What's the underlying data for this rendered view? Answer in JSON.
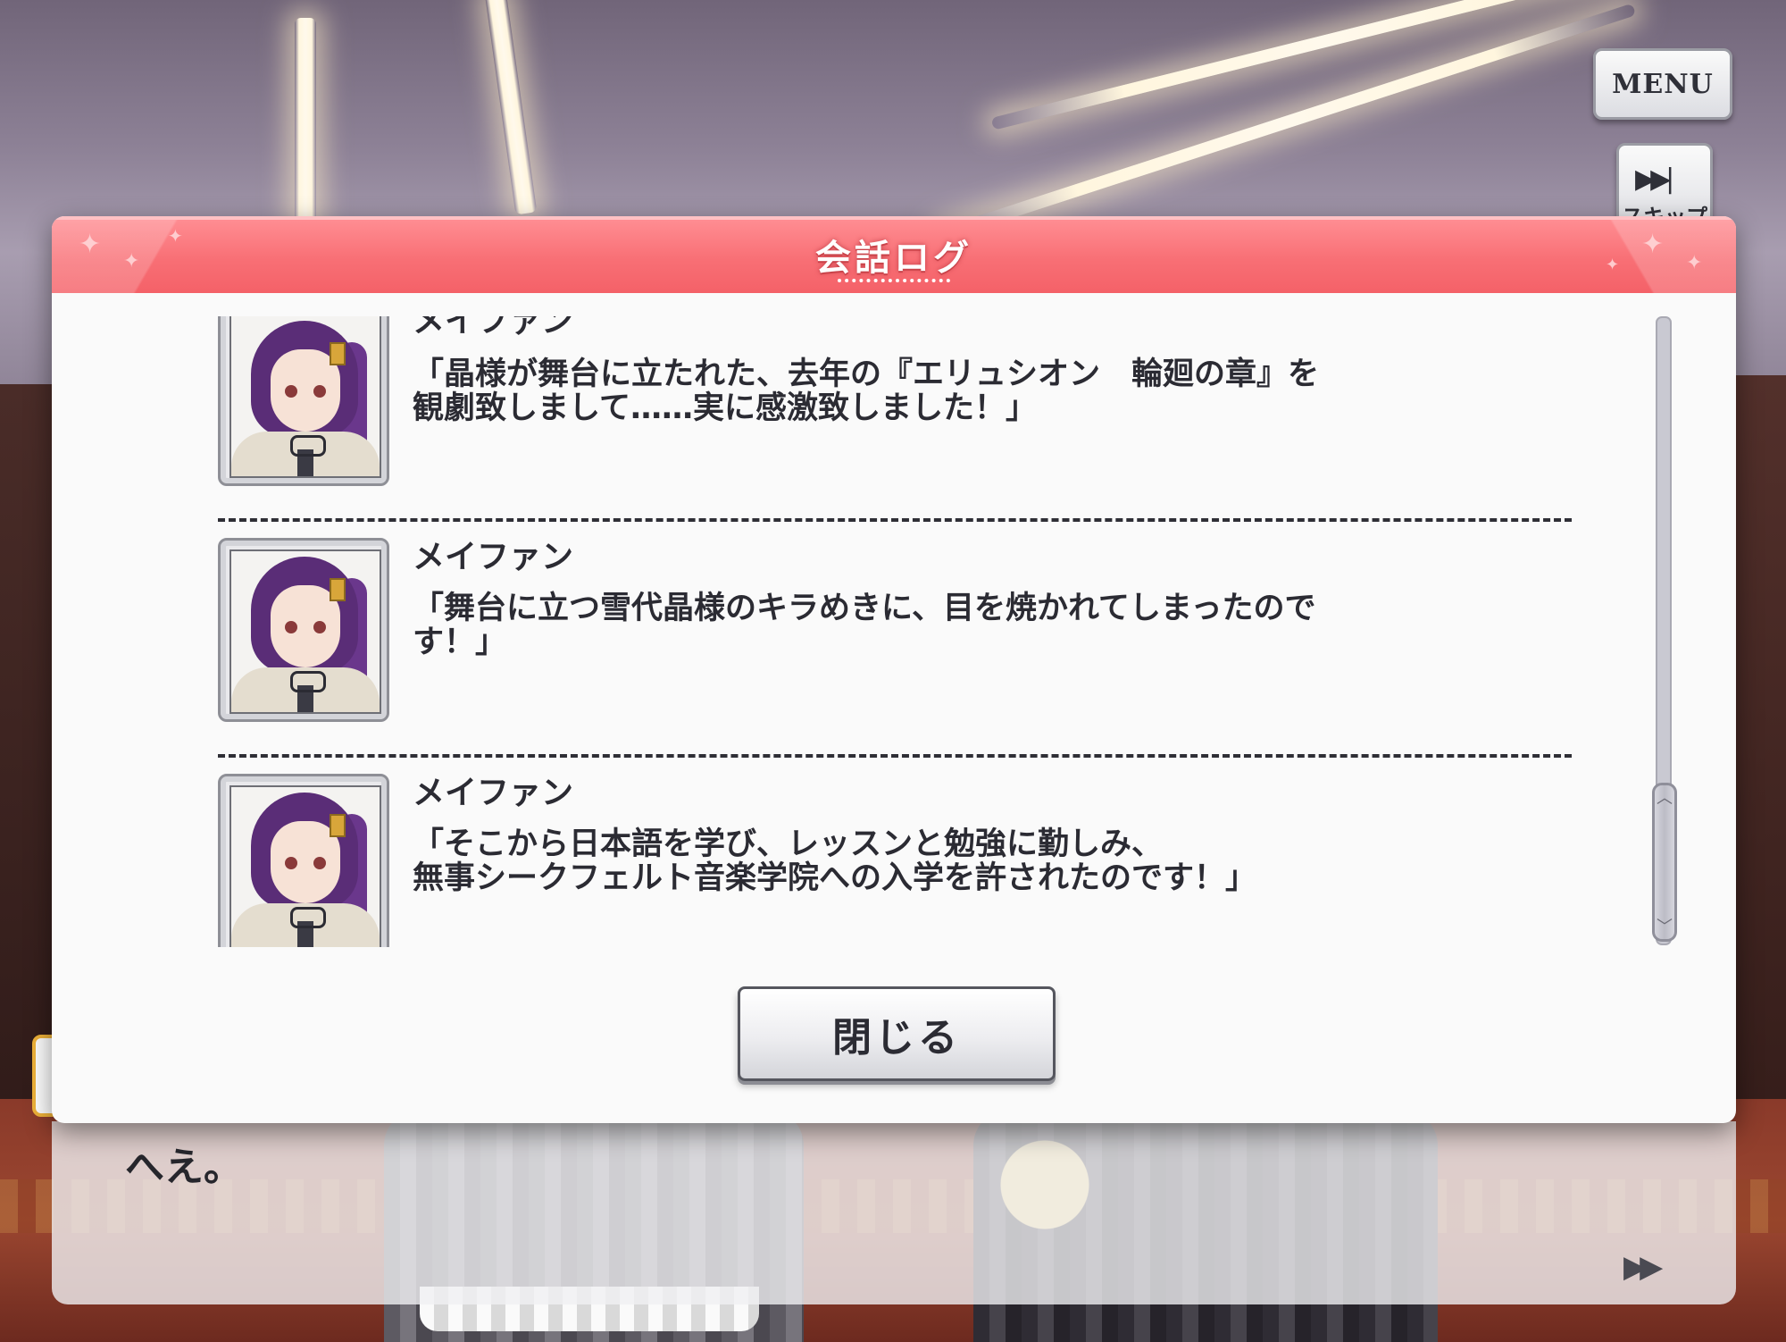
{
  "menu": {
    "menu_label": "MENU",
    "skip_label": "スキップ",
    "skip_icon": "skip-forward-icon"
  },
  "log": {
    "title": "会話ログ",
    "entries": [
      {
        "speaker": "メイファン",
        "lines": [
          "「晶様が舞台に立たれた、去年の『エリュシオン　輪廻の章』を",
          "観劇致しまして……実に感激致しました！」"
        ]
      },
      {
        "speaker": "メイファン",
        "lines": [
          "「舞台に立つ雪代晶様のキラめきに、目を焼かれてしまったので",
          "す！」"
        ]
      },
      {
        "speaker": "メイファン",
        "lines": [
          "「そこから日本語を学び、レッスンと勉強に勤しみ、",
          "無事シークフェルト音楽学院への入学を許されたのです！」"
        ]
      }
    ],
    "close_label": "閉じる"
  },
  "dialogue": {
    "text": "へえ。",
    "advance_icon": "fast-forward-icon"
  },
  "colors": {
    "header": "#f86f75",
    "text": "#2b2b33"
  }
}
